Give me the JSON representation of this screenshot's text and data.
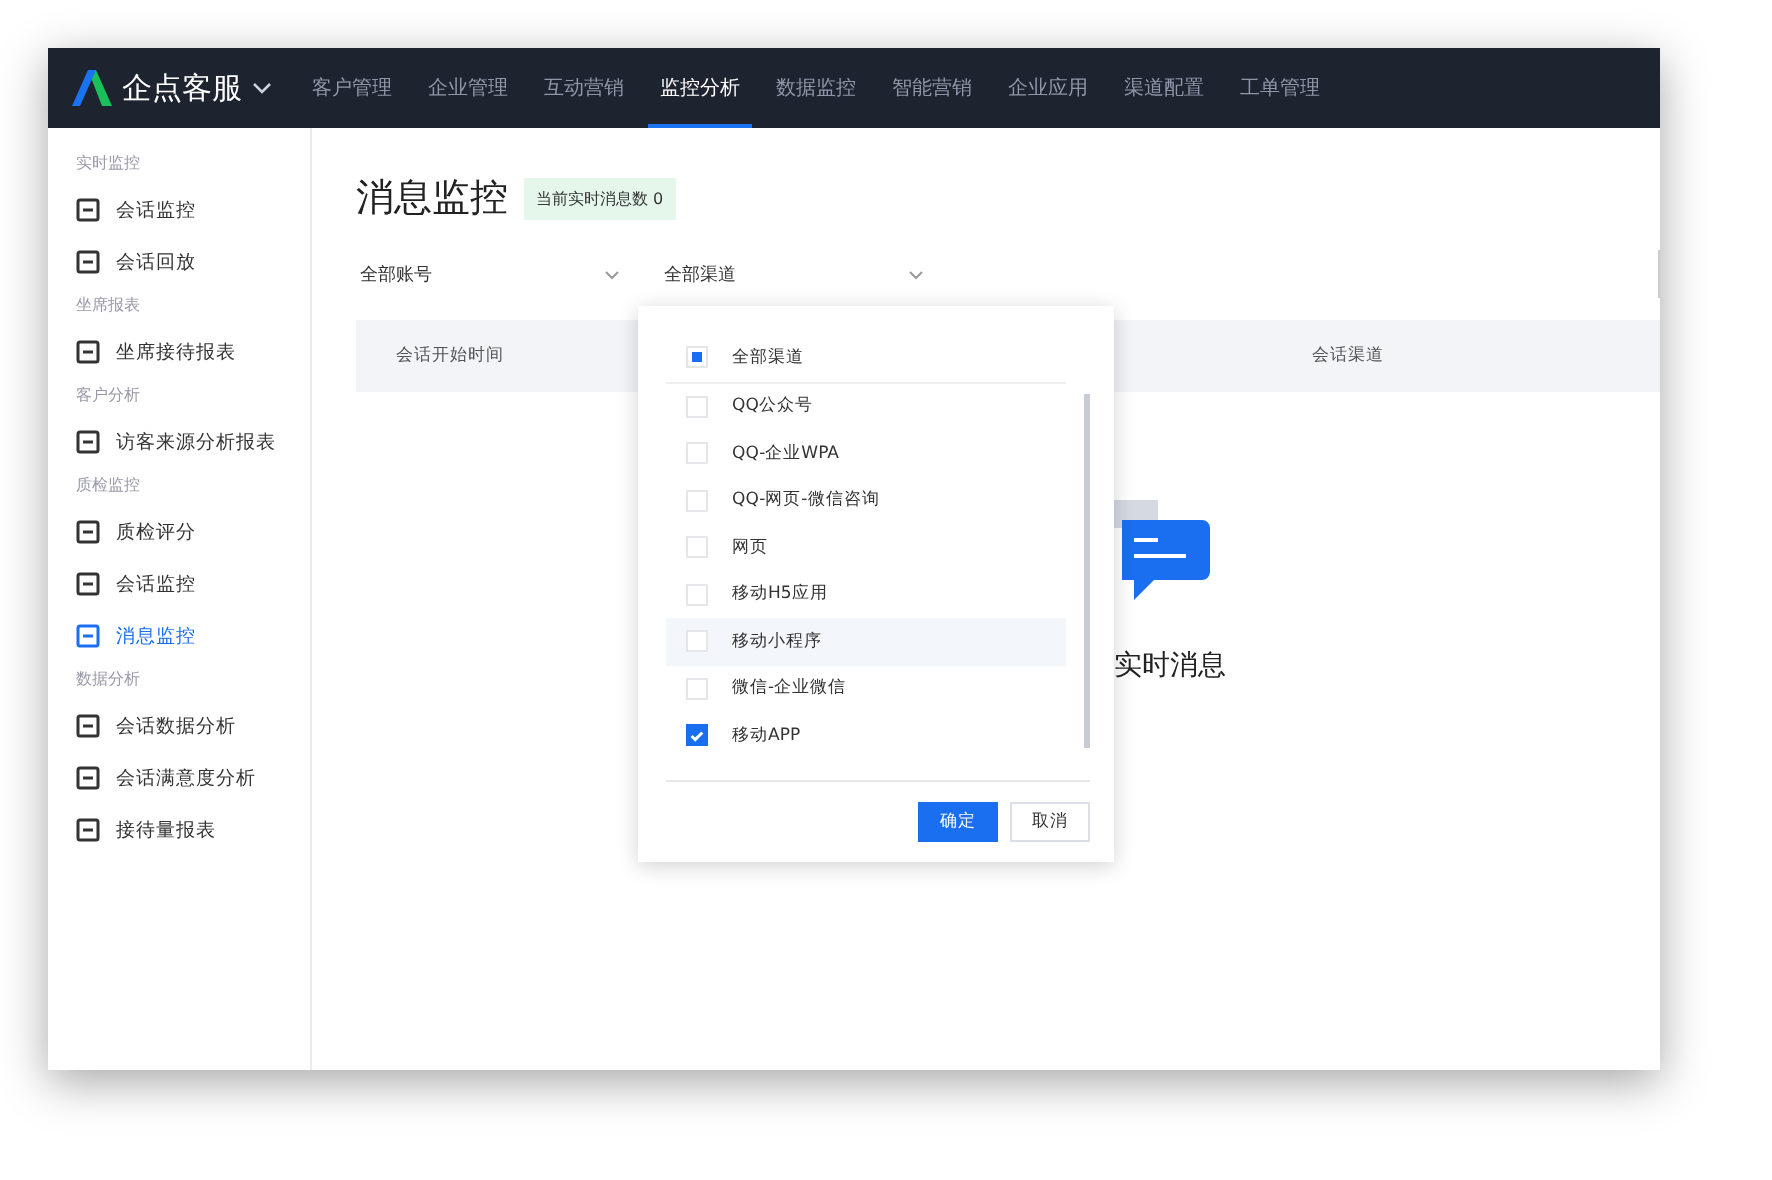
{
  "brand": {
    "name": "企点客服"
  },
  "nav": [
    {
      "label": "客户管理",
      "selected": false
    },
    {
      "label": "企业管理",
      "selected": false
    },
    {
      "label": "互动营销",
      "selected": false
    },
    {
      "label": "监控分析",
      "selected": true
    },
    {
      "label": "数据监控",
      "selected": false
    },
    {
      "label": "智能营销",
      "selected": false
    },
    {
      "label": "企业应用",
      "selected": false
    },
    {
      "label": "渠道配置",
      "selected": false
    },
    {
      "label": "工单管理",
      "selected": false
    }
  ],
  "sidebar": [
    {
      "title": "实时监控",
      "items": [
        {
          "label": "会话监控",
          "selected": false
        },
        {
          "label": "会话回放",
          "selected": false
        }
      ]
    },
    {
      "title": "坐席报表",
      "items": [
        {
          "label": "坐席接待报表",
          "selected": false
        }
      ]
    },
    {
      "title": "客户分析",
      "items": [
        {
          "label": "访客来源分析报表",
          "selected": false
        }
      ]
    },
    {
      "title": "质检监控",
      "items": [
        {
          "label": "质检评分",
          "selected": false
        },
        {
          "label": "会话监控",
          "selected": false
        },
        {
          "label": "消息监控",
          "selected": true
        }
      ]
    },
    {
      "title": "数据分析",
      "items": [
        {
          "label": "会话数据分析",
          "selected": false
        },
        {
          "label": "会话满意度分析",
          "selected": false
        },
        {
          "label": "接待量报表",
          "selected": false
        }
      ]
    }
  ],
  "page": {
    "title": "消息监控",
    "badge": "当前实时消息数 0"
  },
  "filters": [
    {
      "value": "全部账号"
    },
    {
      "value": "全部渠道"
    }
  ],
  "table": {
    "columns": [
      "会话开始时间",
      "会话渠道"
    ]
  },
  "empty": {
    "text": "实时消息"
  },
  "dropdown": {
    "select_all": {
      "label": "全部渠道",
      "indeterminate": true
    },
    "options": [
      {
        "label": "QQ公众号",
        "checked": false,
        "hover": false
      },
      {
        "label": "QQ-企业WPA",
        "checked": false,
        "hover": false
      },
      {
        "label": "QQ-网页-微信咨询",
        "checked": false,
        "hover": false
      },
      {
        "label": "网页",
        "checked": false,
        "hover": false
      },
      {
        "label": "移动H5应用",
        "checked": false,
        "hover": false
      },
      {
        "label": "移动小程序",
        "checked": false,
        "hover": true
      },
      {
        "label": "微信-企业微信",
        "checked": false,
        "hover": false
      },
      {
        "label": "移动APP",
        "checked": true,
        "hover": false
      }
    ],
    "buttons": [
      {
        "label": "确定",
        "kind": "primary"
      },
      {
        "label": "取消",
        "kind": "default"
      }
    ]
  }
}
